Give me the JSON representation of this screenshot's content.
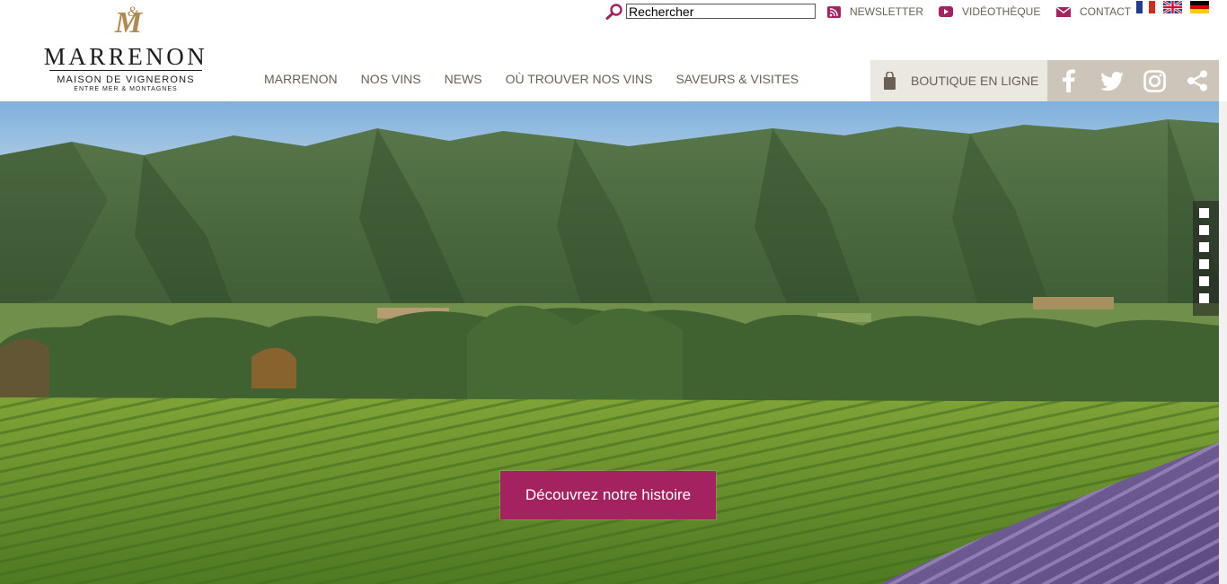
{
  "brand": {
    "monogram": "&M",
    "name": "MARRENON",
    "tagline": "MAISON DE VIGNERONS",
    "subtagline": "ENTRE MER & MONTAGNES"
  },
  "search": {
    "value": "Rechercher"
  },
  "utility": {
    "newsletter": "NEWSLETTER",
    "videotheque": "VIDÉOTHÈQUE",
    "contact": "CONTACT"
  },
  "languages": [
    "fr",
    "en",
    "de"
  ],
  "nav": {
    "items": [
      {
        "label": "MARRENON"
      },
      {
        "label": "NOS VINS"
      },
      {
        "label": "NEWS"
      },
      {
        "label": "OÙ TROUVER NOS VINS"
      },
      {
        "label": "SAVEURS & VISITES"
      }
    ]
  },
  "shop": {
    "label": "BOUTIQUE EN LIGNE",
    "icon": "shopping-bag-icon"
  },
  "social": [
    "facebook-icon",
    "twitter-icon",
    "instagram-icon",
    "share-icon"
  ],
  "hero": {
    "cta_label": "Découvrez notre histoire",
    "slides": 6,
    "image": "vineyard-mountains-lavender"
  },
  "colors": {
    "accent": "#a3225f",
    "text": "#6a5f52",
    "shop_bg": "#ebe7e1",
    "social_bg": "#cdc5b9",
    "gold": "#b08a4e"
  }
}
